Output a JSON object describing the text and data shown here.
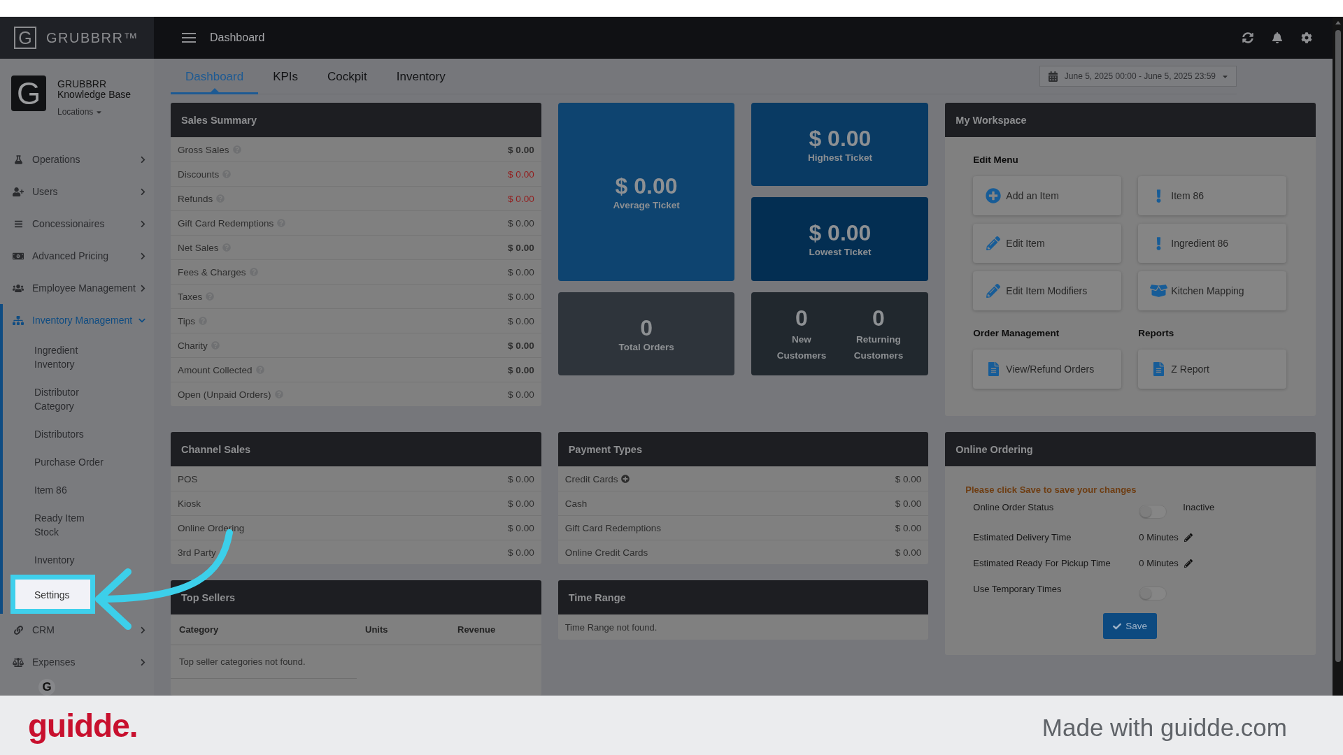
{
  "brand": {
    "mark": "G",
    "name": "GRUBBRR™"
  },
  "profile": {
    "avatar": "G",
    "name": "GRUBBRR Knowledge Base",
    "location": "Locations"
  },
  "nav": [
    {
      "label": "Operations",
      "expanded": false
    },
    {
      "label": "Users",
      "expanded": false
    },
    {
      "label": "Concessionaires",
      "expanded": false
    },
    {
      "label": "Advanced Pricing",
      "expanded": false
    },
    {
      "label": "Employee Management",
      "expanded": false
    },
    {
      "label": "Inventory Management",
      "expanded": true,
      "children": [
        {
          "label": "Ingredient Inventory",
          "highlighted": false
        },
        {
          "label": "Distributor Category",
          "highlighted": false
        },
        {
          "label": "Distributors",
          "highlighted": false
        },
        {
          "label": "Purchase Order",
          "highlighted": false
        },
        {
          "label": "Item 86",
          "highlighted": false
        },
        {
          "label": "Ready Item Stock",
          "highlighted": false
        },
        {
          "label": "Inventory",
          "highlighted": false
        },
        {
          "label": "Settings",
          "highlighted": true
        }
      ]
    },
    {
      "label": "CRM",
      "expanded": false
    },
    {
      "label": "Expenses",
      "expanded": false
    }
  ],
  "help_button": {
    "mark": "G"
  },
  "top_bar": {
    "title": "Dashboard"
  },
  "tabs": [
    {
      "label": "Dashboard",
      "selected": true
    },
    {
      "label": "KPIs",
      "selected": false
    },
    {
      "label": "Cockpit",
      "selected": false
    },
    {
      "label": "Inventory",
      "selected": false
    }
  ],
  "date_range": "June 5, 2025 00:00 - June 5, 2025 23:59",
  "sales_summary": {
    "title": "Sales Summary",
    "rows": [
      {
        "label": "Gross Sales",
        "value": "$ 0.00",
        "kind": "total"
      },
      {
        "label": "Discounts",
        "value": "$ 0.00",
        "kind": "deduction"
      },
      {
        "label": "Refunds",
        "value": "$ 0.00",
        "kind": "deduction"
      },
      {
        "label": "Gift Card Redemptions",
        "value": "$ 0.00",
        "kind": "plain"
      },
      {
        "label": "Net Sales",
        "value": "$ 0.00",
        "kind": "total"
      },
      {
        "label": "Fees & Charges",
        "value": "$ 0.00",
        "kind": "plain"
      },
      {
        "label": "Taxes",
        "value": "$ 0.00",
        "kind": "plain"
      },
      {
        "label": "Tips",
        "value": "$ 0.00",
        "kind": "plain"
      },
      {
        "label": "Charity",
        "value": "$ 0.00",
        "kind": "total"
      },
      {
        "label": "Amount Collected",
        "value": "$ 0.00",
        "kind": "total"
      },
      {
        "label": "Open (Unpaid Orders)",
        "value": "$ 0.00",
        "kind": "plain"
      }
    ]
  },
  "kpi_tiles": [
    {
      "kind": "single",
      "color": "#0e4470",
      "value": "$ 0.00",
      "label": "Average Ticket"
    },
    {
      "kind": "single",
      "color": "#093a63",
      "value": "$ 0.00",
      "label": "Highest Ticket"
    },
    {
      "kind": "single",
      "color": "#032e52",
      "value": "$ 0.00",
      "label": "Lowest Ticket"
    },
    {
      "kind": "single",
      "color": "#2e343b",
      "value": "0",
      "label": "Total Orders"
    },
    {
      "kind": "pair",
      "color": "#21282e",
      "stats": [
        {
          "value": "0",
          "label": "New Customers"
        },
        {
          "value": "0",
          "label": "Returning Customers"
        }
      ]
    }
  ],
  "workspace": {
    "title": "My Workspace",
    "sections": [
      {
        "title": "Edit Menu",
        "actions": [
          {
            "label": "Add an Item",
            "kind": "add"
          },
          {
            "label": "Item 86",
            "kind": "alert"
          },
          {
            "label": "Edit Item",
            "kind": "edit"
          },
          {
            "label": "Ingredient 86",
            "kind": "alert"
          },
          {
            "label": "Edit Item Modifiers",
            "kind": "edit"
          },
          {
            "label": "Kitchen Mapping",
            "kind": "mapping"
          }
        ]
      },
      {
        "title": "Order Management",
        "actions": [
          {
            "label": "View/Refund Orders",
            "kind": "document"
          }
        ]
      },
      {
        "title": "Reports",
        "actions": [
          {
            "label": "Z Report",
            "kind": "document"
          }
        ]
      }
    ]
  },
  "channel_sales": {
    "title": "Channel Sales",
    "rows": [
      {
        "label": "POS",
        "value": "$ 0.00"
      },
      {
        "label": "Kiosk",
        "value": "$ 0.00"
      },
      {
        "label": "Online Ordering",
        "value": "$ 0.00"
      },
      {
        "label": "3rd Party",
        "value": "$ 0.00"
      }
    ]
  },
  "payment_types": {
    "title": "Payment Types",
    "rows": [
      {
        "label": "Credit Cards",
        "value": "$ 0.00",
        "expandable": true
      },
      {
        "label": "Cash",
        "value": "$ 0.00",
        "expandable": false
      },
      {
        "label": "Gift Card Redemptions",
        "value": "$ 0.00",
        "expandable": false
      },
      {
        "label": "Online Credit Cards",
        "value": "$ 0.00",
        "expandable": false
      }
    ]
  },
  "online_ordering": {
    "title": "Online Ordering",
    "notice": "Please click Save to save your changes",
    "fields": [
      {
        "kind": "toggle",
        "label": "Online Order Status",
        "on": false,
        "status": "Inactive"
      },
      {
        "kind": "time",
        "label": "Estimated Delivery Time",
        "value": "0 Minutes"
      },
      {
        "kind": "time",
        "label": "Estimated Ready For Pickup Time",
        "value": "0 Minutes"
      },
      {
        "kind": "toggle",
        "label": "Use Temporary Times",
        "on": false
      }
    ],
    "save_label": "Save"
  },
  "top_sellers": {
    "title": "Top Sellers",
    "columns": [
      "Category",
      "Units",
      "Revenue"
    ],
    "empty_message": "Top seller categories not found."
  },
  "time_range": {
    "title": "Time Range",
    "empty_message": "Time Range not found."
  },
  "footer": {
    "logo": "guidde.",
    "credit": "Made with guidde.com"
  }
}
